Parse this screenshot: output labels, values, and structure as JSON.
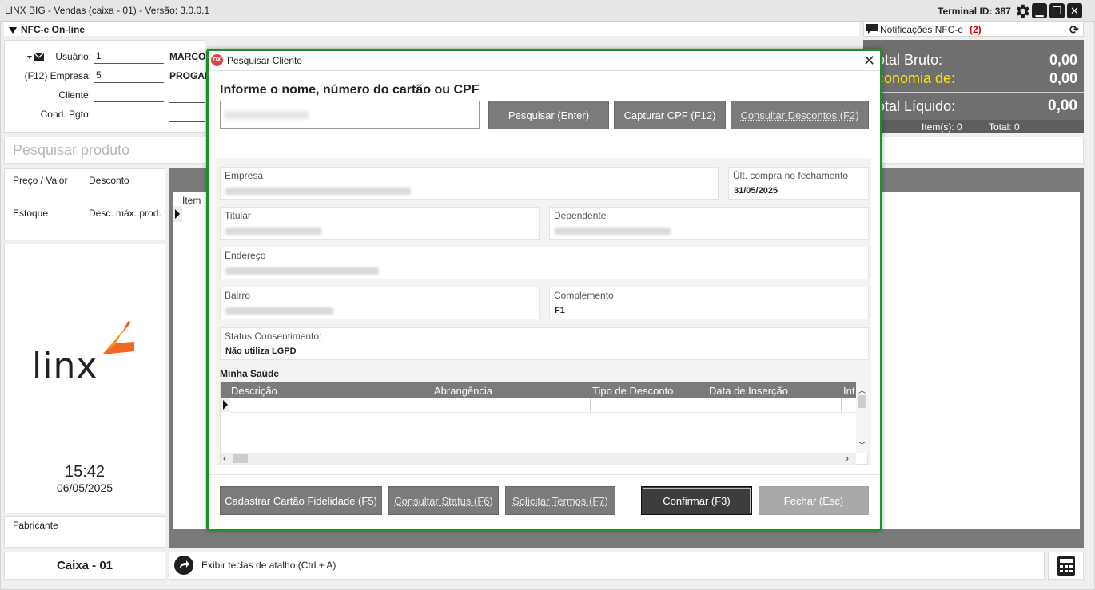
{
  "app": {
    "title": "LINX BIG - Vendas (caixa - 01) - Versão: 3.0.0.1",
    "terminal": "Terminal ID: 387"
  },
  "nfce": {
    "label": "NFC-e On-line"
  },
  "form": {
    "usuario_label": "Usuário:",
    "usuario_value": "1",
    "usuario_name": "MARCO",
    "empresa_label": "(F12) Empresa:",
    "empresa_value": "5",
    "empresa_name": "PROGAM",
    "cliente_label": "Cliente:",
    "cond_label": "Cond. Pgto:"
  },
  "search_product": {
    "placeholder": "Pesquisar produto"
  },
  "price": {
    "preco_label": "Preço / Valor",
    "desconto_label": "Desconto",
    "estoque_label": "Estoque",
    "desc_max_label": "Desc. máx. prod."
  },
  "grid": {
    "item_label": "Item"
  },
  "brand": {
    "logo_text": "linx"
  },
  "clock": {
    "time": "15:42",
    "date": "06/05/2025"
  },
  "fabricante": {
    "label": "Fabricante"
  },
  "caixa": {
    "label": "Caixa - 01"
  },
  "shortcut": {
    "label": "Exibir teclas de atalho (Ctrl + A)"
  },
  "notifications": {
    "label": "Notificações NFC-e",
    "count": "(2)"
  },
  "totals": {
    "bruto_label": "otal Bruto:",
    "bruto_value": "0,00",
    "economia_label": "conomia de:",
    "economia_value": "0,00",
    "liquido_label": "otal Líquido:",
    "liquido_value": "0,00",
    "items_label": "Item(s): 0",
    "total_label": "Total: 0"
  },
  "colors": {
    "modal_border": "#1f8f2b",
    "economia": "#ffe600",
    "notif_count": "#d60000",
    "logo_orange": "#f26522"
  },
  "modal": {
    "title": "Pesquisar Cliente",
    "icon_text": "DX",
    "close": "✕",
    "prompt": "Informe o nome, número do cartão ou CPF",
    "buttons": {
      "pesquisar": "Pesquisar (Enter)",
      "capturar": "Capturar CPF (F12)",
      "consultar_descontos": "Consultar Descontos (F2)",
      "cadastrar": "Cadastrar Cartão Fidelidade (F5)",
      "consultar_status": "Consultar Status (F6)",
      "solicitar": "Solicitar Termos (F7)",
      "confirmar": "Confirmar (F3)",
      "fechar": "Fechar (Esc)"
    },
    "fields": {
      "empresa_label": "Empresa",
      "empresa_value": "ALFA SISTEMAS DE REFRIGERACAO LTDA",
      "ult_compra_label": "Últ. compra no fechamento",
      "ult_compra_value": "31/05/2025",
      "titular_label": "Titular",
      "titular_value": "CARLOS TOUTO LINX",
      "dependente_label": "Dependente",
      "dependente_value": "CLIENTE HOMOLOGACAO",
      "endereco_label": "Endereço",
      "endereco_value": "RUA BENVINDO DE OLIVEIRA 123",
      "bairro_label": "Bairro",
      "bairro_value": "CONJUNTO PRIMAVERA",
      "complemento_label": "Complemento",
      "complemento_value": "F1",
      "status_label": "Status Consentimento:",
      "status_value": "Não utiliza LGPD"
    },
    "saude": {
      "title": "Minha Saúde",
      "columns": [
        "Descrição",
        "Abrangência",
        "Tipo de Desconto",
        "Data de Inserção",
        "Int"
      ]
    }
  }
}
